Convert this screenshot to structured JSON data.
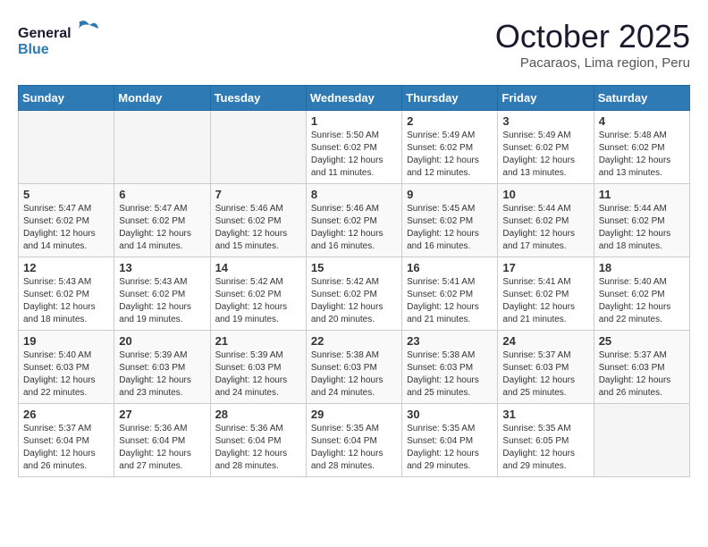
{
  "header": {
    "logo_line1": "General",
    "logo_line2": "Blue",
    "title": "October 2025",
    "subtitle": "Pacaraos, Lima region, Peru"
  },
  "weekdays": [
    "Sunday",
    "Monday",
    "Tuesday",
    "Wednesday",
    "Thursday",
    "Friday",
    "Saturday"
  ],
  "weeks": [
    [
      {
        "day": "",
        "info": ""
      },
      {
        "day": "",
        "info": ""
      },
      {
        "day": "",
        "info": ""
      },
      {
        "day": "1",
        "info": "Sunrise: 5:50 AM\nSunset: 6:02 PM\nDaylight: 12 hours\nand 11 minutes."
      },
      {
        "day": "2",
        "info": "Sunrise: 5:49 AM\nSunset: 6:02 PM\nDaylight: 12 hours\nand 12 minutes."
      },
      {
        "day": "3",
        "info": "Sunrise: 5:49 AM\nSunset: 6:02 PM\nDaylight: 12 hours\nand 13 minutes."
      },
      {
        "day": "4",
        "info": "Sunrise: 5:48 AM\nSunset: 6:02 PM\nDaylight: 12 hours\nand 13 minutes."
      }
    ],
    [
      {
        "day": "5",
        "info": "Sunrise: 5:47 AM\nSunset: 6:02 PM\nDaylight: 12 hours\nand 14 minutes."
      },
      {
        "day": "6",
        "info": "Sunrise: 5:47 AM\nSunset: 6:02 PM\nDaylight: 12 hours\nand 14 minutes."
      },
      {
        "day": "7",
        "info": "Sunrise: 5:46 AM\nSunset: 6:02 PM\nDaylight: 12 hours\nand 15 minutes."
      },
      {
        "day": "8",
        "info": "Sunrise: 5:46 AM\nSunset: 6:02 PM\nDaylight: 12 hours\nand 16 minutes."
      },
      {
        "day": "9",
        "info": "Sunrise: 5:45 AM\nSunset: 6:02 PM\nDaylight: 12 hours\nand 16 minutes."
      },
      {
        "day": "10",
        "info": "Sunrise: 5:44 AM\nSunset: 6:02 PM\nDaylight: 12 hours\nand 17 minutes."
      },
      {
        "day": "11",
        "info": "Sunrise: 5:44 AM\nSunset: 6:02 PM\nDaylight: 12 hours\nand 18 minutes."
      }
    ],
    [
      {
        "day": "12",
        "info": "Sunrise: 5:43 AM\nSunset: 6:02 PM\nDaylight: 12 hours\nand 18 minutes."
      },
      {
        "day": "13",
        "info": "Sunrise: 5:43 AM\nSunset: 6:02 PM\nDaylight: 12 hours\nand 19 minutes."
      },
      {
        "day": "14",
        "info": "Sunrise: 5:42 AM\nSunset: 6:02 PM\nDaylight: 12 hours\nand 19 minutes."
      },
      {
        "day": "15",
        "info": "Sunrise: 5:42 AM\nSunset: 6:02 PM\nDaylight: 12 hours\nand 20 minutes."
      },
      {
        "day": "16",
        "info": "Sunrise: 5:41 AM\nSunset: 6:02 PM\nDaylight: 12 hours\nand 21 minutes."
      },
      {
        "day": "17",
        "info": "Sunrise: 5:41 AM\nSunset: 6:02 PM\nDaylight: 12 hours\nand 21 minutes."
      },
      {
        "day": "18",
        "info": "Sunrise: 5:40 AM\nSunset: 6:02 PM\nDaylight: 12 hours\nand 22 minutes."
      }
    ],
    [
      {
        "day": "19",
        "info": "Sunrise: 5:40 AM\nSunset: 6:03 PM\nDaylight: 12 hours\nand 22 minutes."
      },
      {
        "day": "20",
        "info": "Sunrise: 5:39 AM\nSunset: 6:03 PM\nDaylight: 12 hours\nand 23 minutes."
      },
      {
        "day": "21",
        "info": "Sunrise: 5:39 AM\nSunset: 6:03 PM\nDaylight: 12 hours\nand 24 minutes."
      },
      {
        "day": "22",
        "info": "Sunrise: 5:38 AM\nSunset: 6:03 PM\nDaylight: 12 hours\nand 24 minutes."
      },
      {
        "day": "23",
        "info": "Sunrise: 5:38 AM\nSunset: 6:03 PM\nDaylight: 12 hours\nand 25 minutes."
      },
      {
        "day": "24",
        "info": "Sunrise: 5:37 AM\nSunset: 6:03 PM\nDaylight: 12 hours\nand 25 minutes."
      },
      {
        "day": "25",
        "info": "Sunrise: 5:37 AM\nSunset: 6:03 PM\nDaylight: 12 hours\nand 26 minutes."
      }
    ],
    [
      {
        "day": "26",
        "info": "Sunrise: 5:37 AM\nSunset: 6:04 PM\nDaylight: 12 hours\nand 26 minutes."
      },
      {
        "day": "27",
        "info": "Sunrise: 5:36 AM\nSunset: 6:04 PM\nDaylight: 12 hours\nand 27 minutes."
      },
      {
        "day": "28",
        "info": "Sunrise: 5:36 AM\nSunset: 6:04 PM\nDaylight: 12 hours\nand 28 minutes."
      },
      {
        "day": "29",
        "info": "Sunrise: 5:35 AM\nSunset: 6:04 PM\nDaylight: 12 hours\nand 28 minutes."
      },
      {
        "day": "30",
        "info": "Sunrise: 5:35 AM\nSunset: 6:04 PM\nDaylight: 12 hours\nand 29 minutes."
      },
      {
        "day": "31",
        "info": "Sunrise: 5:35 AM\nSunset: 6:05 PM\nDaylight: 12 hours\nand 29 minutes."
      },
      {
        "day": "",
        "info": ""
      }
    ]
  ]
}
